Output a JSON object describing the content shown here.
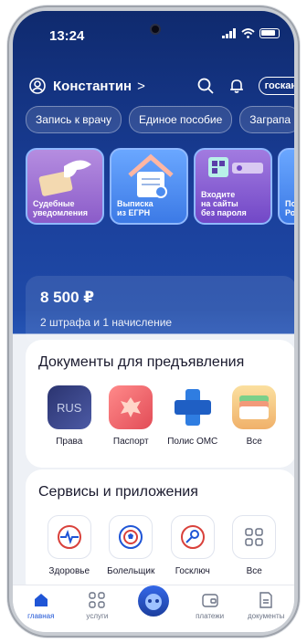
{
  "status": {
    "time": "13:24"
  },
  "header": {
    "user_name": "Константин",
    "user_chevron": ">",
    "gos_badge": "госкан"
  },
  "chips": [
    "Запись к врачу",
    "Единое пособие",
    "Заграпа"
  ],
  "cards": [
    {
      "label": "Судебные\nуведомления"
    },
    {
      "label": "Выписка\nиз ЕГРН"
    },
    {
      "label": "Входите\nна сайты\nбез пароля"
    },
    {
      "label": "По\nРо"
    }
  ],
  "fines": {
    "amount": "8 500 ₽",
    "subtitle": "2 штрафа и 1 начисление"
  },
  "documents": {
    "title": "Документы для предъявления",
    "items": [
      {
        "label": "Права",
        "badge": "RUS"
      },
      {
        "label": "Паспорт"
      },
      {
        "label": "Полис ОМС"
      },
      {
        "label": "Все"
      }
    ]
  },
  "services": {
    "title": "Сервисы и приложения",
    "items": [
      {
        "label": "Здоровье"
      },
      {
        "label": "Болельщик"
      },
      {
        "label": "Госключ"
      },
      {
        "label": "Все"
      }
    ]
  },
  "tabs": [
    {
      "label": "главная",
      "active": true
    },
    {
      "label": "услуги"
    },
    {
      "label": ""
    },
    {
      "label": "платежи"
    },
    {
      "label": "документы"
    }
  ],
  "colors": {
    "accent": "#1f55d6",
    "header_bg": "#1a3f9a"
  }
}
